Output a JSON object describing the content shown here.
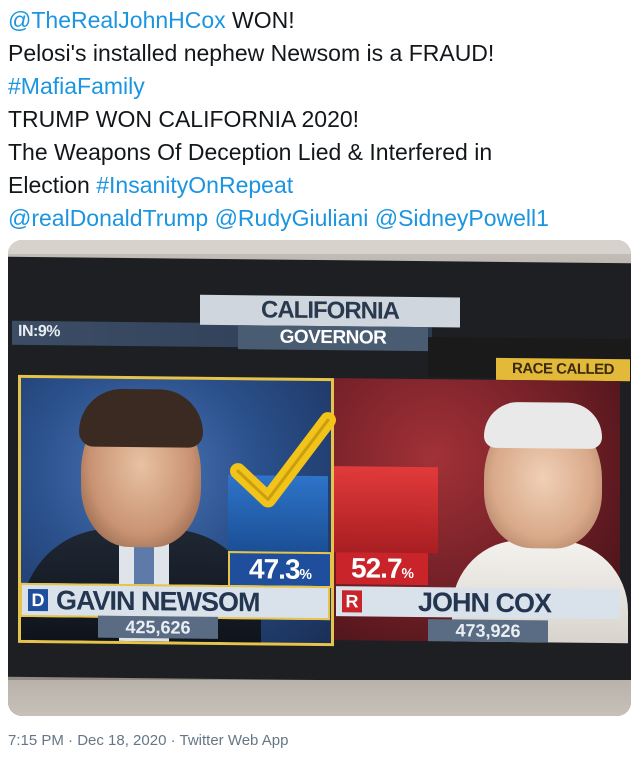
{
  "tweet": {
    "cutoff_line": "...",
    "lines": [
      [
        {
          "t": "mention",
          "v": "@TheRealJohnHCox"
        },
        {
          "t": "text",
          "v": " WON!"
        }
      ],
      [
        {
          "t": "text",
          "v": "Pelosi's installed nephew Newsom is a FRAUD!"
        }
      ],
      [
        {
          "t": "hashtag",
          "v": "#MafiaFamily"
        }
      ],
      [
        {
          "t": "text",
          "v": "TRUMP WON CALIFORNIA 2020!"
        }
      ],
      [
        {
          "t": "text",
          "v": "The Weapons Of Deception Lied & Interfered in"
        }
      ],
      [
        {
          "t": "text",
          "v": "Election "
        },
        {
          "t": "hashtag",
          "v": "#InsanityOnRepeat"
        }
      ],
      [
        {
          "t": "mention",
          "v": "@realDonaldTrump"
        },
        {
          "t": "text",
          "v": " "
        },
        {
          "t": "mention",
          "v": "@RudyGiuliani"
        },
        {
          "t": "text",
          "v": " "
        },
        {
          "t": "mention",
          "v": "@SidneyPowell1"
        }
      ]
    ]
  },
  "media": {
    "header_state": "CALIFORNIA",
    "header_race": "GOVERNOR",
    "in_reporting": "IN:9%",
    "race_called": "RACE CALLED",
    "dem": {
      "party": "D",
      "name": "GAVIN NEWSOM",
      "pct": "47.3",
      "pct_sign": "%",
      "votes": "425,626"
    },
    "rep": {
      "party": "R",
      "name": "JOHN COX",
      "pct": "52.7",
      "pct_sign": "%",
      "votes": "473,926"
    },
    "colors": {
      "dem": "#1f4f9c",
      "rep": "#c8242a",
      "check": "#f2c318",
      "race_called": "#e3b93a"
    }
  },
  "footer": {
    "timestamp": "7:15 PM · Dec 18, 2020 · Twitter Web App"
  }
}
